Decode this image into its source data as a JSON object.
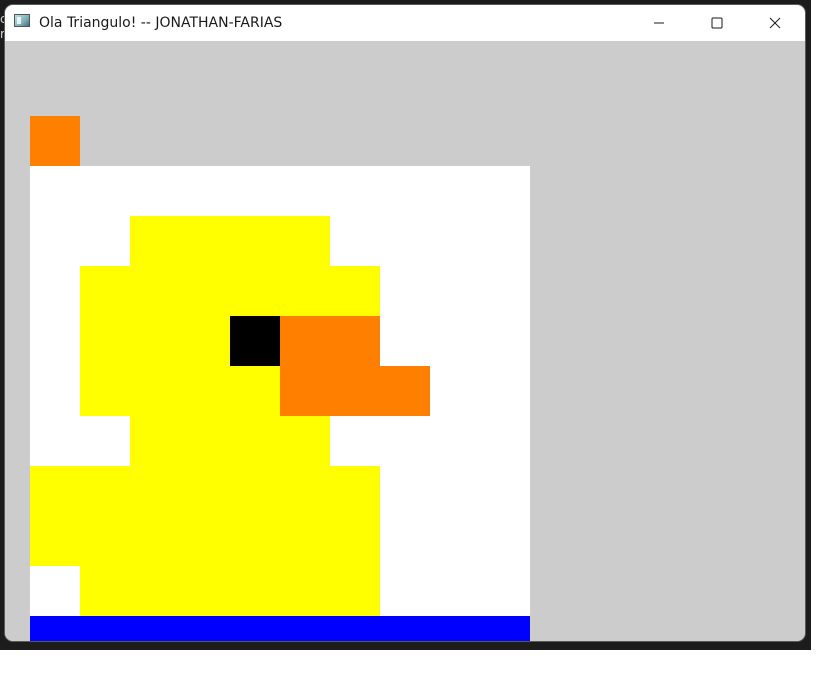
{
  "window": {
    "title": "Ola Triangulo! -- JONATHAN-FARIAS",
    "background_color": "#cccccc"
  },
  "background_app": {
    "visible_chars": [
      "c",
      "r"
    ]
  },
  "titlebar_buttons": {
    "minimize_icon": "minimize-icon",
    "maximize_icon": "maximize-icon",
    "close_icon": "close-icon"
  },
  "canvas": {
    "description_colors": {
      "white": "#ffffff",
      "yellow": "#ffff00",
      "orange": "#ff8000",
      "black": "#000000",
      "blue": "#0000ff"
    }
  }
}
